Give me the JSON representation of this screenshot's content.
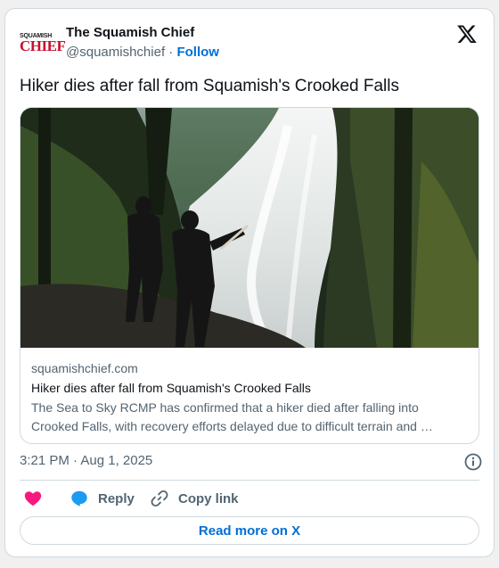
{
  "account": {
    "avatar_top": "SQUAMISH",
    "avatar_main": "CHIEF",
    "name": "The Squamish Chief",
    "handle": "@squamishchief",
    "separator": "·",
    "follow_label": "Follow"
  },
  "icons": {
    "x_logo": "x-logo-icon",
    "info": "info-icon",
    "heart": "heart-icon",
    "reply": "reply-bubble-icon",
    "copy_link": "link-icon"
  },
  "tweet": {
    "text": "Hiker dies after fall from Squamish's Crooked Falls"
  },
  "link_card": {
    "image_description": "waterfall-photo",
    "domain": "squamishchief.com",
    "title": "Hiker dies after fall from Squamish's Crooked Falls",
    "description": "The Sea to Sky RCMP has confirmed that a hiker died after falling into Crooked Falls, with recovery efforts delayed due to difficult terrain and …"
  },
  "meta": {
    "timestamp": "3:21 PM · Aug 1, 2025"
  },
  "actions": {
    "reply_label": "Reply",
    "copy_link_label": "Copy link",
    "read_more_label": "Read more on X"
  },
  "colors": {
    "accent": "#006fd6",
    "heart": "#f91880",
    "reply": "#1d9bf0",
    "brand_red": "#c8102e"
  }
}
